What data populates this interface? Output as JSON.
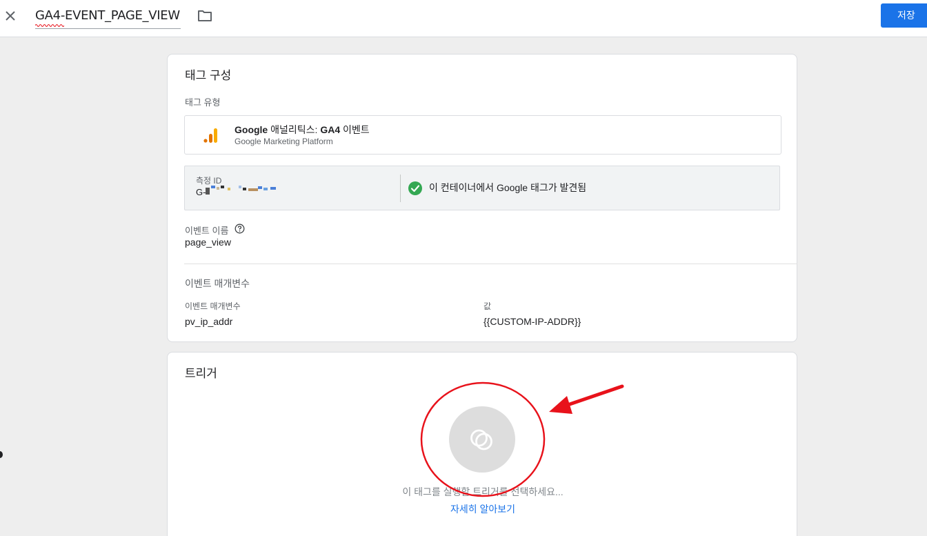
{
  "header": {
    "tag_name": "GA4-EVENT_PAGE_VIEW",
    "save_label": "저장"
  },
  "config": {
    "title": "태그 구성",
    "tag_type_label": "태그 유형",
    "tag_type_name_bold1": "Google",
    "tag_type_name_mid": " 애널리틱스: ",
    "tag_type_name_bold2": "GA4",
    "tag_type_name_end": " 이벤트",
    "tag_type_sub": "Google Marketing Platform",
    "measurement_id_label": "측정 ID",
    "measurement_id_prefix": "G-",
    "google_tag_found": "이 컨테이너에서 Google 태그가 발견됨",
    "event_name_label": "이벤트 이름",
    "event_name_value": "page_view",
    "event_params_title": "이벤트 매개변수",
    "param_header": "이벤트 매개변수",
    "value_header": "값",
    "params": [
      {
        "name": "pv_ip_addr",
        "value": "{{CUSTOM-IP-ADDR}}"
      }
    ]
  },
  "trigger": {
    "title": "트리거",
    "hint": "이 태그를 실행할 트리거를 선택하세요...",
    "learn_more": "자세히 알아보기"
  },
  "colors": {
    "accent": "#1a73e8",
    "success": "#34a853",
    "ga_orange": "#f9ab00",
    "ga_dark_orange": "#e37400",
    "annotation_red": "#e8121b"
  },
  "icons": {
    "close": "close-icon",
    "folder": "folder-icon",
    "analytics": "google-analytics-icon",
    "check": "check-circle-icon",
    "help": "help-icon",
    "trigger": "trigger-placeholder-icon"
  }
}
